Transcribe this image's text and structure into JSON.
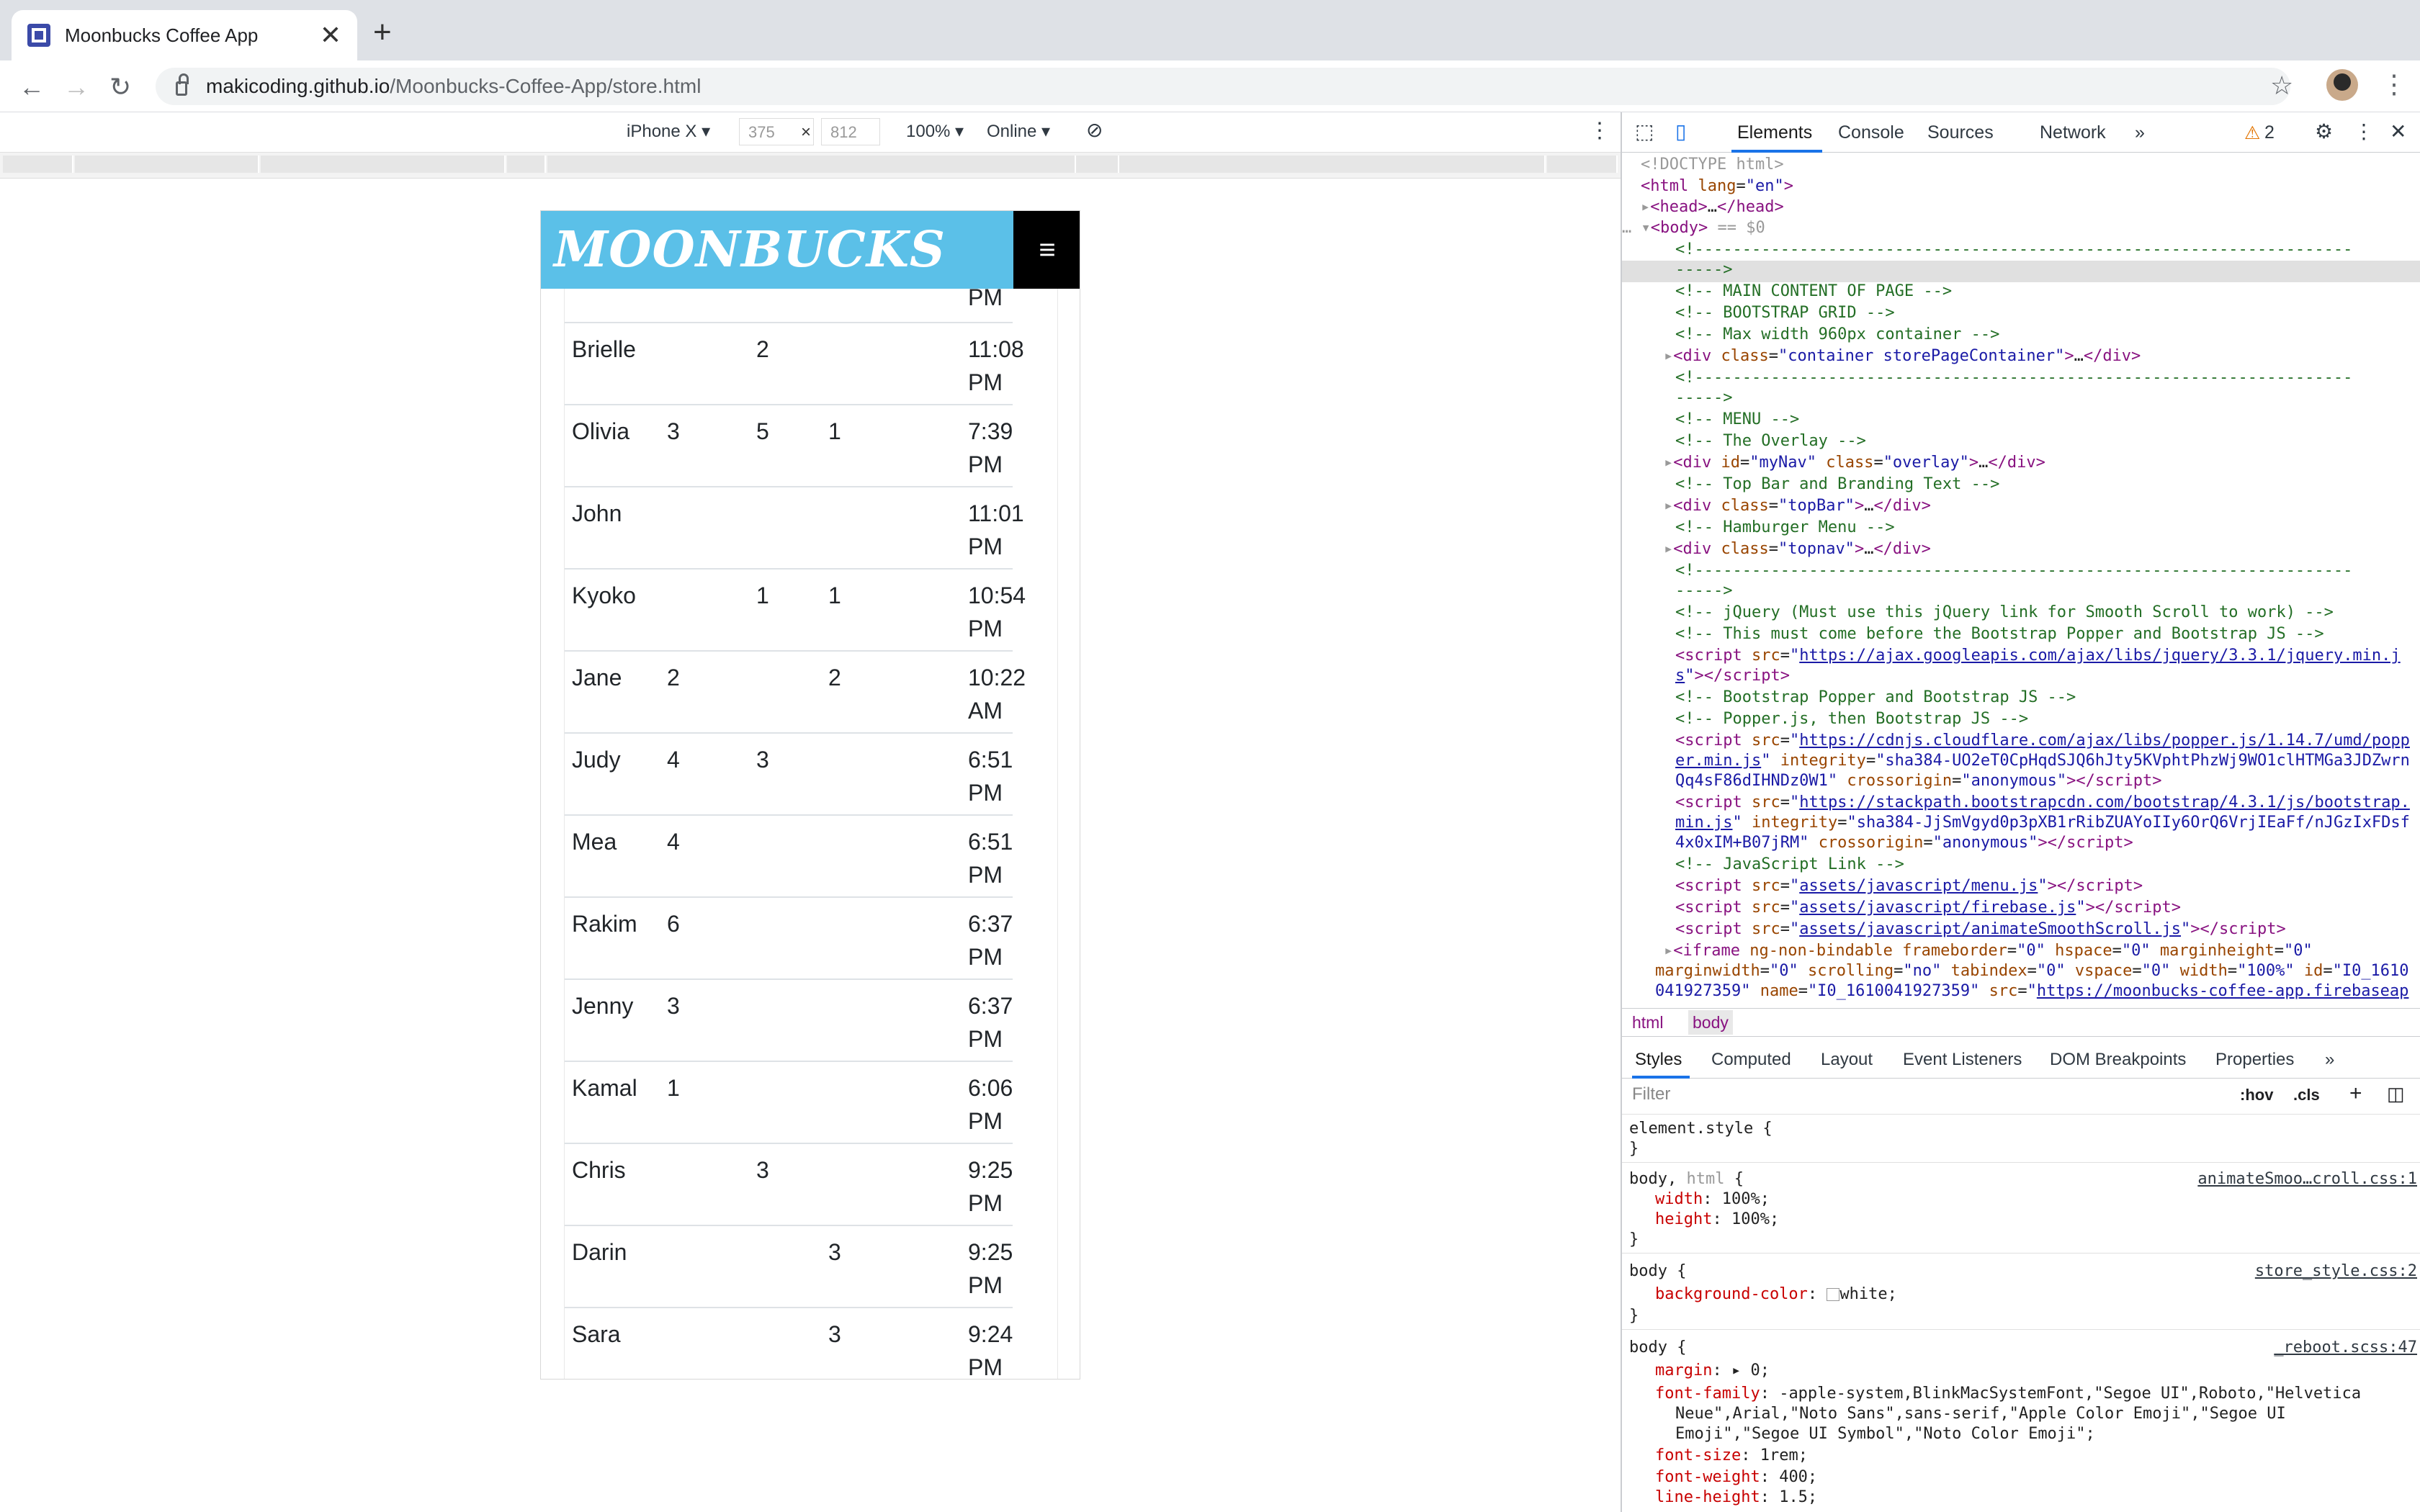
{
  "browser": {
    "tab_title": "Moonbucks Coffee App",
    "url_host": "makicoding.github.io",
    "url_path": "/Moonbucks-Coffee-App/store.html"
  },
  "device_toolbar": {
    "device": "iPhone X ▾",
    "width": "375",
    "times": "×",
    "height": "812",
    "zoom": "100% ▾",
    "network": "Online ▾"
  },
  "page": {
    "logo": "MOONBUCKS",
    "menu_icon": "≡",
    "partial_top": "PM",
    "orders": [
      {
        "name": "Brielle",
        "a": "",
        "b": "2",
        "c": "",
        "time1": "11:08",
        "time2": "PM"
      },
      {
        "name": "Olivia",
        "a": "3",
        "b": "5",
        "c": "1",
        "time1": "7:39",
        "time2": "PM"
      },
      {
        "name": "John",
        "a": "",
        "b": "",
        "c": "",
        "time1": "11:01",
        "time2": "PM"
      },
      {
        "name": "Kyoko",
        "a": "",
        "b": "1",
        "c": "1",
        "time1": "10:54",
        "time2": "PM"
      },
      {
        "name": "Jane",
        "a": "2",
        "b": "",
        "c": "2",
        "time1": "10:22",
        "time2": "AM"
      },
      {
        "name": "Judy",
        "a": "4",
        "b": "3",
        "c": "",
        "time1": "6:51",
        "time2": "PM"
      },
      {
        "name": "Mea",
        "a": "4",
        "b": "",
        "c": "",
        "time1": "6:51",
        "time2": "PM"
      },
      {
        "name": "Rakim",
        "a": "6",
        "b": "",
        "c": "",
        "time1": "6:37",
        "time2": "PM"
      },
      {
        "name": "Jenny",
        "a": "3",
        "b": "",
        "c": "",
        "time1": "6:37",
        "time2": "PM"
      },
      {
        "name": "Kamal",
        "a": "1",
        "b": "",
        "c": "",
        "time1": "6:06",
        "time2": "PM"
      },
      {
        "name": "Chris",
        "a": "",
        "b": "3",
        "c": "",
        "time1": "9:25",
        "time2": "PM"
      },
      {
        "name": "Darin",
        "a": "",
        "b": "",
        "c": "3",
        "time1": "9:25",
        "time2": "PM"
      },
      {
        "name": "Sara",
        "a": "",
        "b": "",
        "c": "3",
        "time1": "9:24",
        "time2": "PM"
      }
    ]
  },
  "devtools": {
    "tabs": [
      "Elements",
      "Console",
      "Sources",
      "Network",
      "»"
    ],
    "warnings": "2",
    "breadcrumbs": [
      "html",
      "body"
    ],
    "subtabs": [
      "Styles",
      "Computed",
      "Layout",
      "Event Listeners",
      "DOM Breakpoints",
      "Properties",
      "»"
    ],
    "filter_placeholder": "Filter",
    "hov": ":hov",
    "cls": ".cls",
    "styles_sources": [
      "animateSmoo…croll.css:1",
      "store_style.css:2",
      "_reboot.scss:47"
    ]
  }
}
